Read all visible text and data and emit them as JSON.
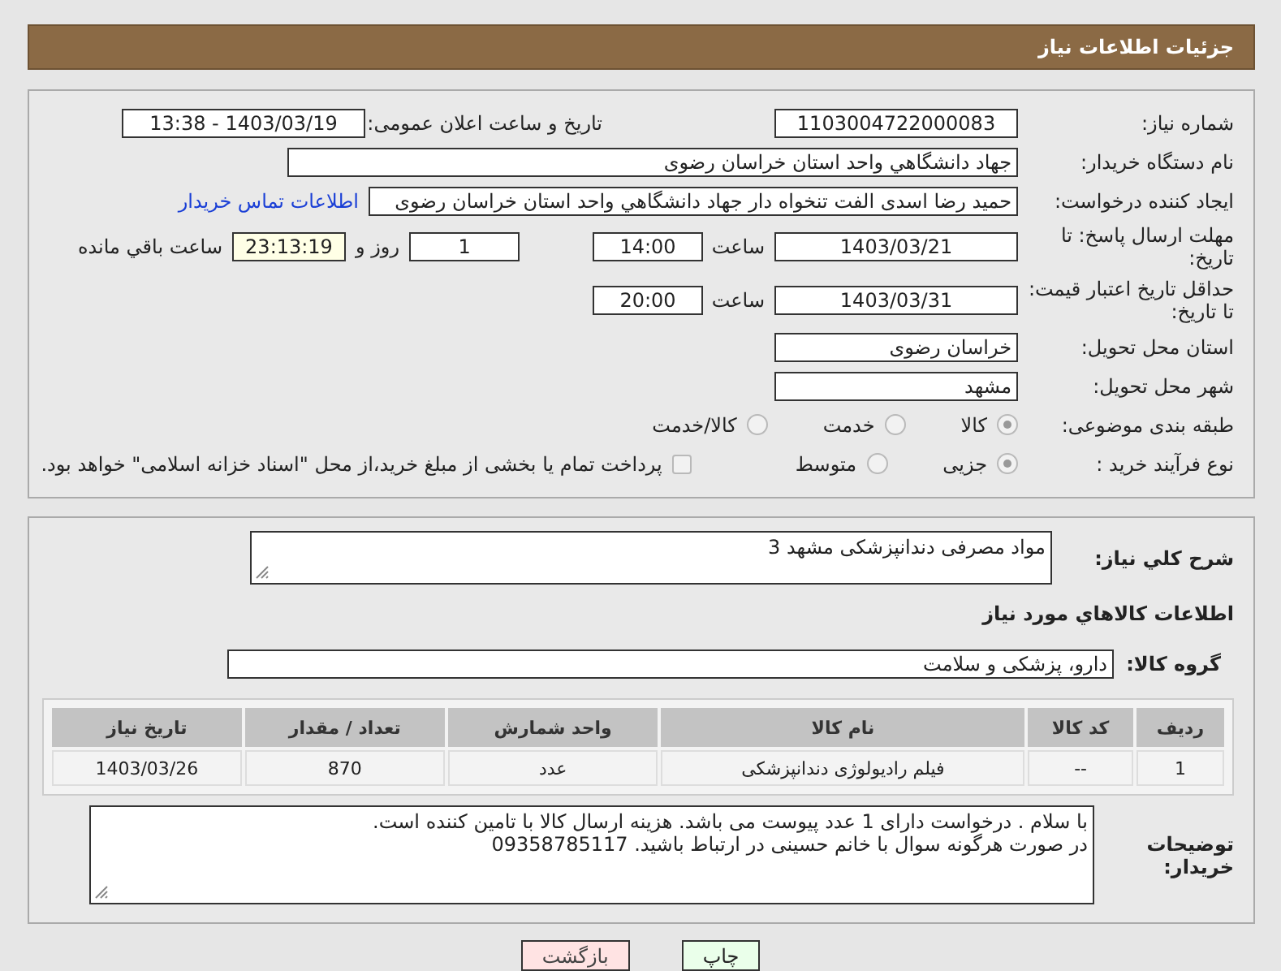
{
  "header": {
    "title": "جزئیات اطلاعات نیاز"
  },
  "details": {
    "need_number": {
      "label": "شماره نیاز:",
      "value": "1103004722000083"
    },
    "announce": {
      "label": "تاریخ و ساعت اعلان عمومی:",
      "value": "1403/03/19 - 13:38"
    },
    "buyer_org": {
      "label": "نام دستگاه خریدار:",
      "value": "جهاد دانشگاهي واحد استان خراسان رضوی"
    },
    "creator": {
      "label": "ایجاد کننده درخواست:",
      "value": "حمید رضا اسدی الفت تنخواه دار جهاد دانشگاهي واحد استان خراسان رضوی",
      "link": "اطلاعات تماس خریدار"
    },
    "deadline": {
      "label": "مهلت ارسال پاسخ: تا تاریخ:",
      "date": "1403/03/21",
      "time_label": "ساعت",
      "time": "14:00",
      "days": "1",
      "days_label": "روز و",
      "remaining": "23:13:19",
      "remaining_label": "ساعت باقي مانده"
    },
    "validity": {
      "label": "حداقل تاریخ اعتبار قیمت: تا تاریخ:",
      "date": "1403/03/31",
      "time_label": "ساعت",
      "time": "20:00"
    },
    "province": {
      "label": "استان محل تحویل:",
      "value": "خراسان رضوی"
    },
    "city": {
      "label": "شهر محل تحویل:",
      "value": "مشهد"
    },
    "category": {
      "label": "طبقه بندی موضوعی:",
      "options": [
        {
          "label": "کالا",
          "selected": true
        },
        {
          "label": "خدمت",
          "selected": false
        },
        {
          "label": "کالا/خدمت",
          "selected": false
        }
      ]
    },
    "process": {
      "label": "نوع فرآیند خرید :",
      "options": [
        {
          "label": "جزیی",
          "selected": true
        },
        {
          "label": "متوسط",
          "selected": false
        }
      ],
      "payment": {
        "label": "پرداخت تمام یا بخشی از مبلغ خرید،از محل \"اسناد خزانه اسلامی\" خواهد بود.",
        "checked": false
      }
    }
  },
  "goods": {
    "summary": {
      "label": "شرح کلي نیاز:",
      "value": "مواد مصرفی دندانپزشکی مشهد 3"
    },
    "section_title": "اطلاعات کالاهاي مورد نیاز",
    "group": {
      "label": "گروه کالا:",
      "value": "دارو، پزشکی و سلامت"
    },
    "table": {
      "columns": [
        "ردیف",
        "کد کالا",
        "نام کالا",
        "واحد شمارش",
        "تعداد / مقدار",
        "تاریخ نیاز"
      ],
      "rows": [
        [
          "1",
          "--",
          "فیلم رادیولوژی دندانپزشکی",
          "عدد",
          "870",
          "1403/03/26"
        ]
      ]
    },
    "notes": {
      "label": "توضیحات خریدار:",
      "lines": [
        "با سلام . درخواست دارای 1 عدد پیوست می باشد. هزینه ارسال کالا با تامین کننده است.",
        "در صورت هرگونه سوال با خانم حسینی در ارتباط باشید. 09358785117"
      ]
    }
  },
  "buttons": [
    {
      "label": "چاپ",
      "kind": "print"
    },
    {
      "label": "بازگشت",
      "kind": "back"
    }
  ]
}
